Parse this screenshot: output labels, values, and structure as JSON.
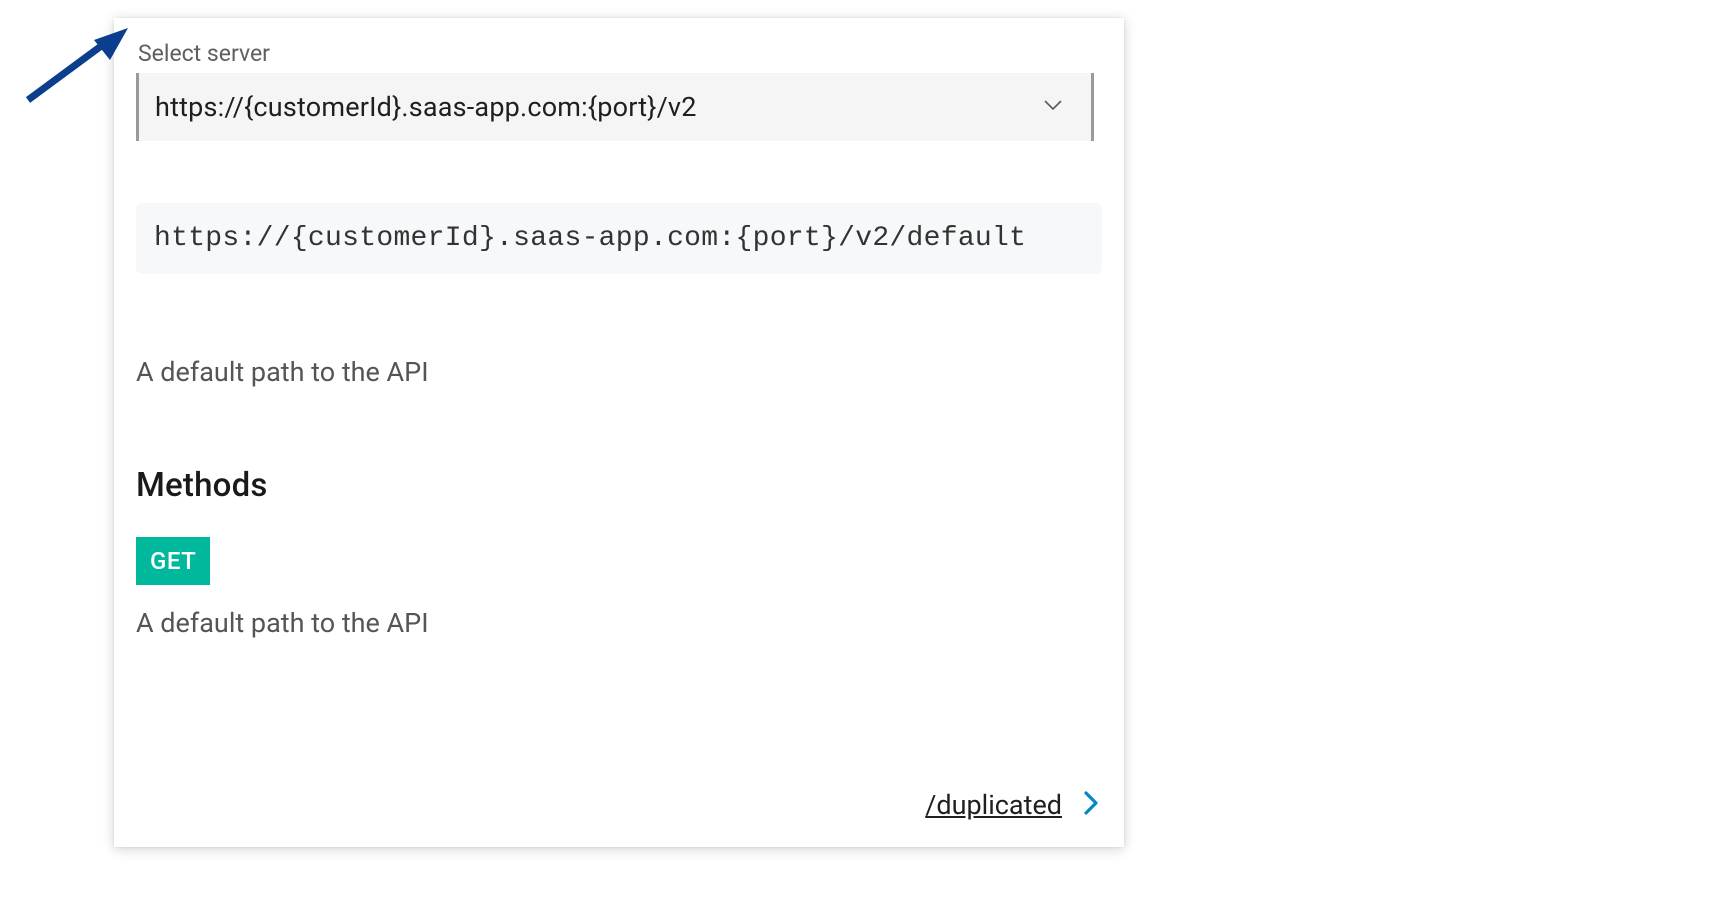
{
  "selectServer": {
    "label": "Select server",
    "selectedValue": "https://{customerId}.saas-app.com:{port}/v2"
  },
  "resolvedUrl": "https://{customerId}.saas-app.com:{port}/v2/default",
  "description": "A default path to the API",
  "methods": {
    "heading": "Methods",
    "items": [
      {
        "verb": "GET",
        "description": "A default path to the API"
      }
    ]
  },
  "footerLink": {
    "label": "/duplicated"
  }
}
